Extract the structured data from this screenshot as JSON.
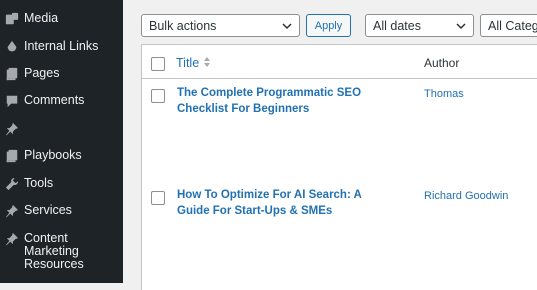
{
  "sidebar": {
    "items": [
      {
        "label": "Media",
        "icon": "media-icon"
      },
      {
        "label": "Internal Links",
        "icon": "link-drop-icon"
      },
      {
        "label": "Pages",
        "icon": "pages-icon"
      },
      {
        "label": "Comments",
        "icon": "comments-icon"
      },
      {
        "label": "",
        "icon": "pin-icon"
      },
      {
        "label": "Playbooks",
        "icon": "pages-icon"
      },
      {
        "label": "Tools",
        "icon": "wrench-icon"
      },
      {
        "label": "Services",
        "icon": "pin-icon"
      },
      {
        "label": "Content Marketing Resources",
        "icon": "pin-icon"
      }
    ]
  },
  "filters": {
    "bulk_actions": "Bulk actions",
    "apply": "Apply",
    "dates": "All dates",
    "categories": "All Catego"
  },
  "table": {
    "columns": {
      "title": "Title",
      "author": "Author"
    },
    "rows": [
      {
        "title": "The Complete Programmatic SEO Checklist For Beginners",
        "author": "Thomas"
      },
      {
        "title": "How To Optimize For AI Search: A Guide For Start-Ups & SMEs",
        "author": "Richard Goodwin"
      }
    ]
  }
}
